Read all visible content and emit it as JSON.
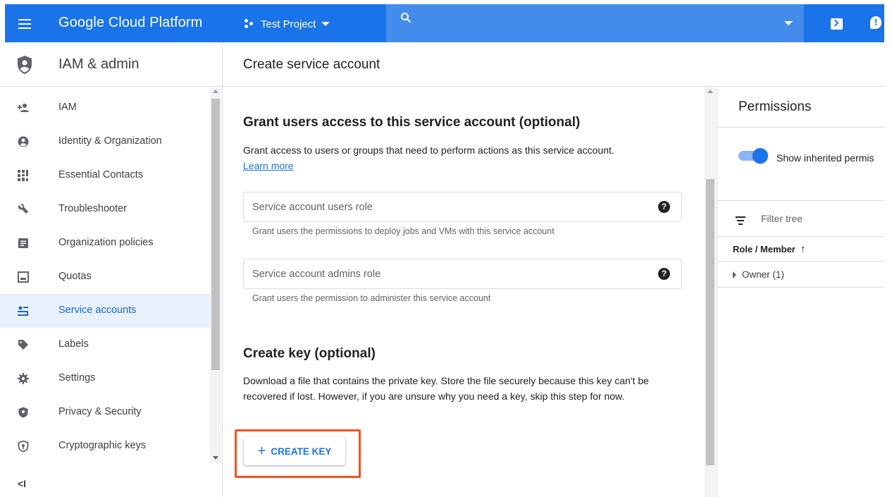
{
  "topbar": {
    "brand": "Google Cloud Platform",
    "project": "Test Project"
  },
  "nav": {
    "title": "IAM & admin",
    "items": [
      {
        "label": "IAM",
        "icon": "add-person-icon"
      },
      {
        "label": "Identity & Organization",
        "icon": "account-circle-icon"
      },
      {
        "label": "Essential Contacts",
        "icon": "contacts-grid-icon"
      },
      {
        "label": "Troubleshooter",
        "icon": "wrench-icon"
      },
      {
        "label": "Organization policies",
        "icon": "document-icon"
      },
      {
        "label": "Quotas",
        "icon": "quota-icon"
      },
      {
        "label": "Service accounts",
        "icon": "service-account-icon",
        "active": true
      },
      {
        "label": "Labels",
        "icon": "tag-icon"
      },
      {
        "label": "Settings",
        "icon": "gear-icon"
      },
      {
        "label": "Privacy & Security",
        "icon": "shield-icon"
      },
      {
        "label": "Cryptographic keys",
        "icon": "key-shield-icon"
      }
    ],
    "collapse_label": "<I"
  },
  "main": {
    "page_title": "Create service account",
    "grant": {
      "title": "Grant users access to this service account (optional)",
      "description": "Grant access to users or groups that need to perform actions as this service account.",
      "learn_more": "Learn more",
      "users_role_placeholder": "Service account users role",
      "users_role_hint": "Grant users the permissions to deploy jobs and VMs with this service account",
      "admins_role_placeholder": "Service account admins role",
      "admins_role_hint": "Grant users the permission to administer this service account"
    },
    "create_key": {
      "title": "Create key (optional)",
      "description": "Download a file that contains the private key. Store the file securely because this key can't be recovered if lost. However, if you are unsure why you need a key, skip this step for now.",
      "button_label": "CREATE KEY"
    }
  },
  "permissions": {
    "title": "Permissions",
    "toggle_label": "Show inherited permis",
    "filter_placeholder": "Filter tree",
    "column_header": "Role / Member",
    "rows": [
      {
        "label": "Owner (1)"
      }
    ]
  },
  "colors": {
    "accent": "#1a73e8",
    "highlight": "#f4511e",
    "active_bg": "#e8f0fe"
  }
}
